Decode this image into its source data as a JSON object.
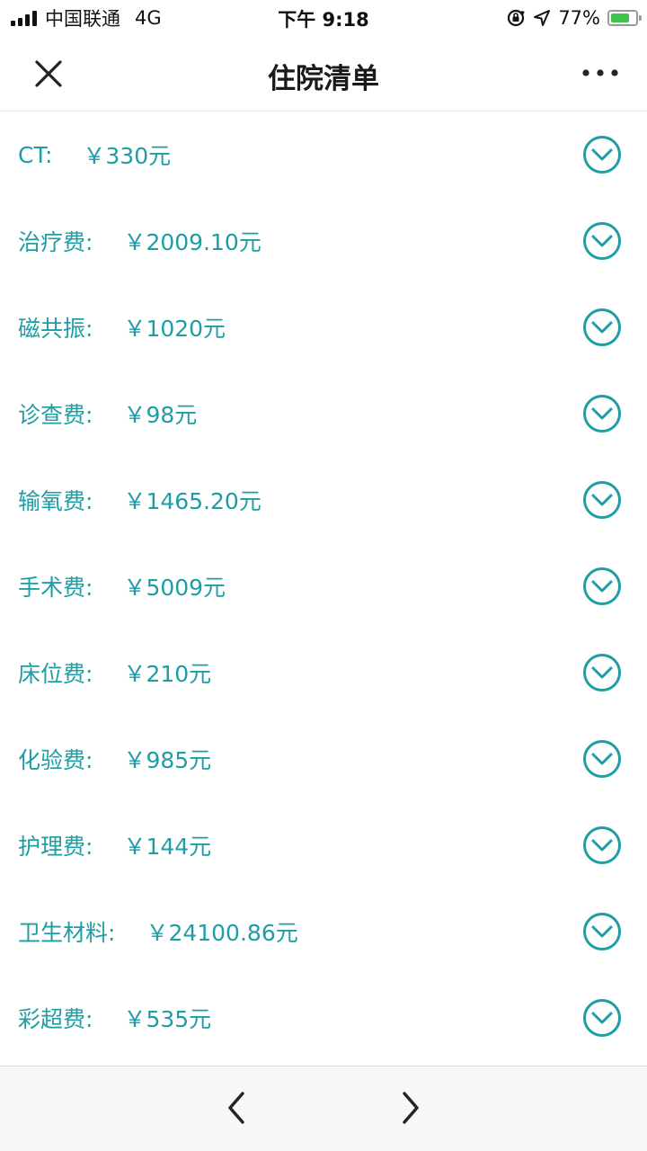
{
  "status_bar": {
    "carrier": "中国联通",
    "network": "4G",
    "time": "下午 9:18",
    "battery_percent": "77%",
    "battery_level": 0.77,
    "icons": [
      "signal-icon",
      "orientation-lock-icon",
      "location-arrow-icon",
      "battery-charging-icon"
    ]
  },
  "header": {
    "title": "住院清单",
    "close_icon": "close-icon",
    "more_icon": "more-icon"
  },
  "items": [
    {
      "name": "CT:",
      "amount": "￥330元"
    },
    {
      "name": "治疗费:",
      "amount": "￥2009.10元"
    },
    {
      "name": "磁共振:",
      "amount": "￥1020元"
    },
    {
      "name": "诊查费:",
      "amount": "￥98元"
    },
    {
      "name": "输氧费:",
      "amount": "￥1465.20元"
    },
    {
      "name": "手术费:",
      "amount": "￥5009元"
    },
    {
      "name": "床位费:",
      "amount": "￥210元"
    },
    {
      "name": "化验费:",
      "amount": "￥985元"
    },
    {
      "name": "护理费:",
      "amount": "￥144元"
    },
    {
      "name": "卫生材料:",
      "amount": "￥24100.86元"
    },
    {
      "name": "彩超费:",
      "amount": "￥535元"
    }
  ],
  "toolbar": {
    "back_icon": "chevron-left-icon",
    "forward_icon": "chevron-right-icon"
  },
  "colors": {
    "accent": "#1e9ea4",
    "title": "#1a1a1a",
    "toolbar_bg": "#f7f7f7"
  }
}
